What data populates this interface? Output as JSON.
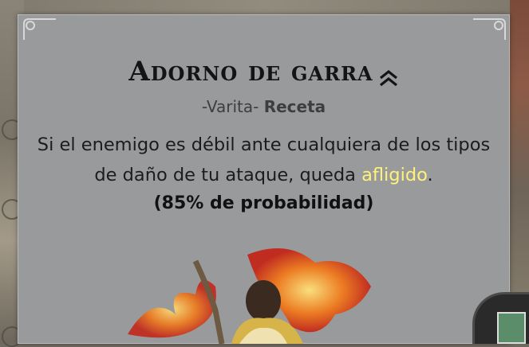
{
  "card": {
    "title": "Adorno de garra",
    "rank_icon": "double-chevron-up-icon",
    "subtitle_type": "-Varita-",
    "subtitle_kind": "Receta",
    "description_before": "Si el enemigo es débil ante cualquiera de los tipos de daño de tu ataque, queda ",
    "keyword": "afligido",
    "description_after": ".",
    "chance": "(85% de probabilidad)"
  },
  "colors": {
    "panel": "#999a9c",
    "keyword": "#fff27a",
    "title": "#141414"
  }
}
